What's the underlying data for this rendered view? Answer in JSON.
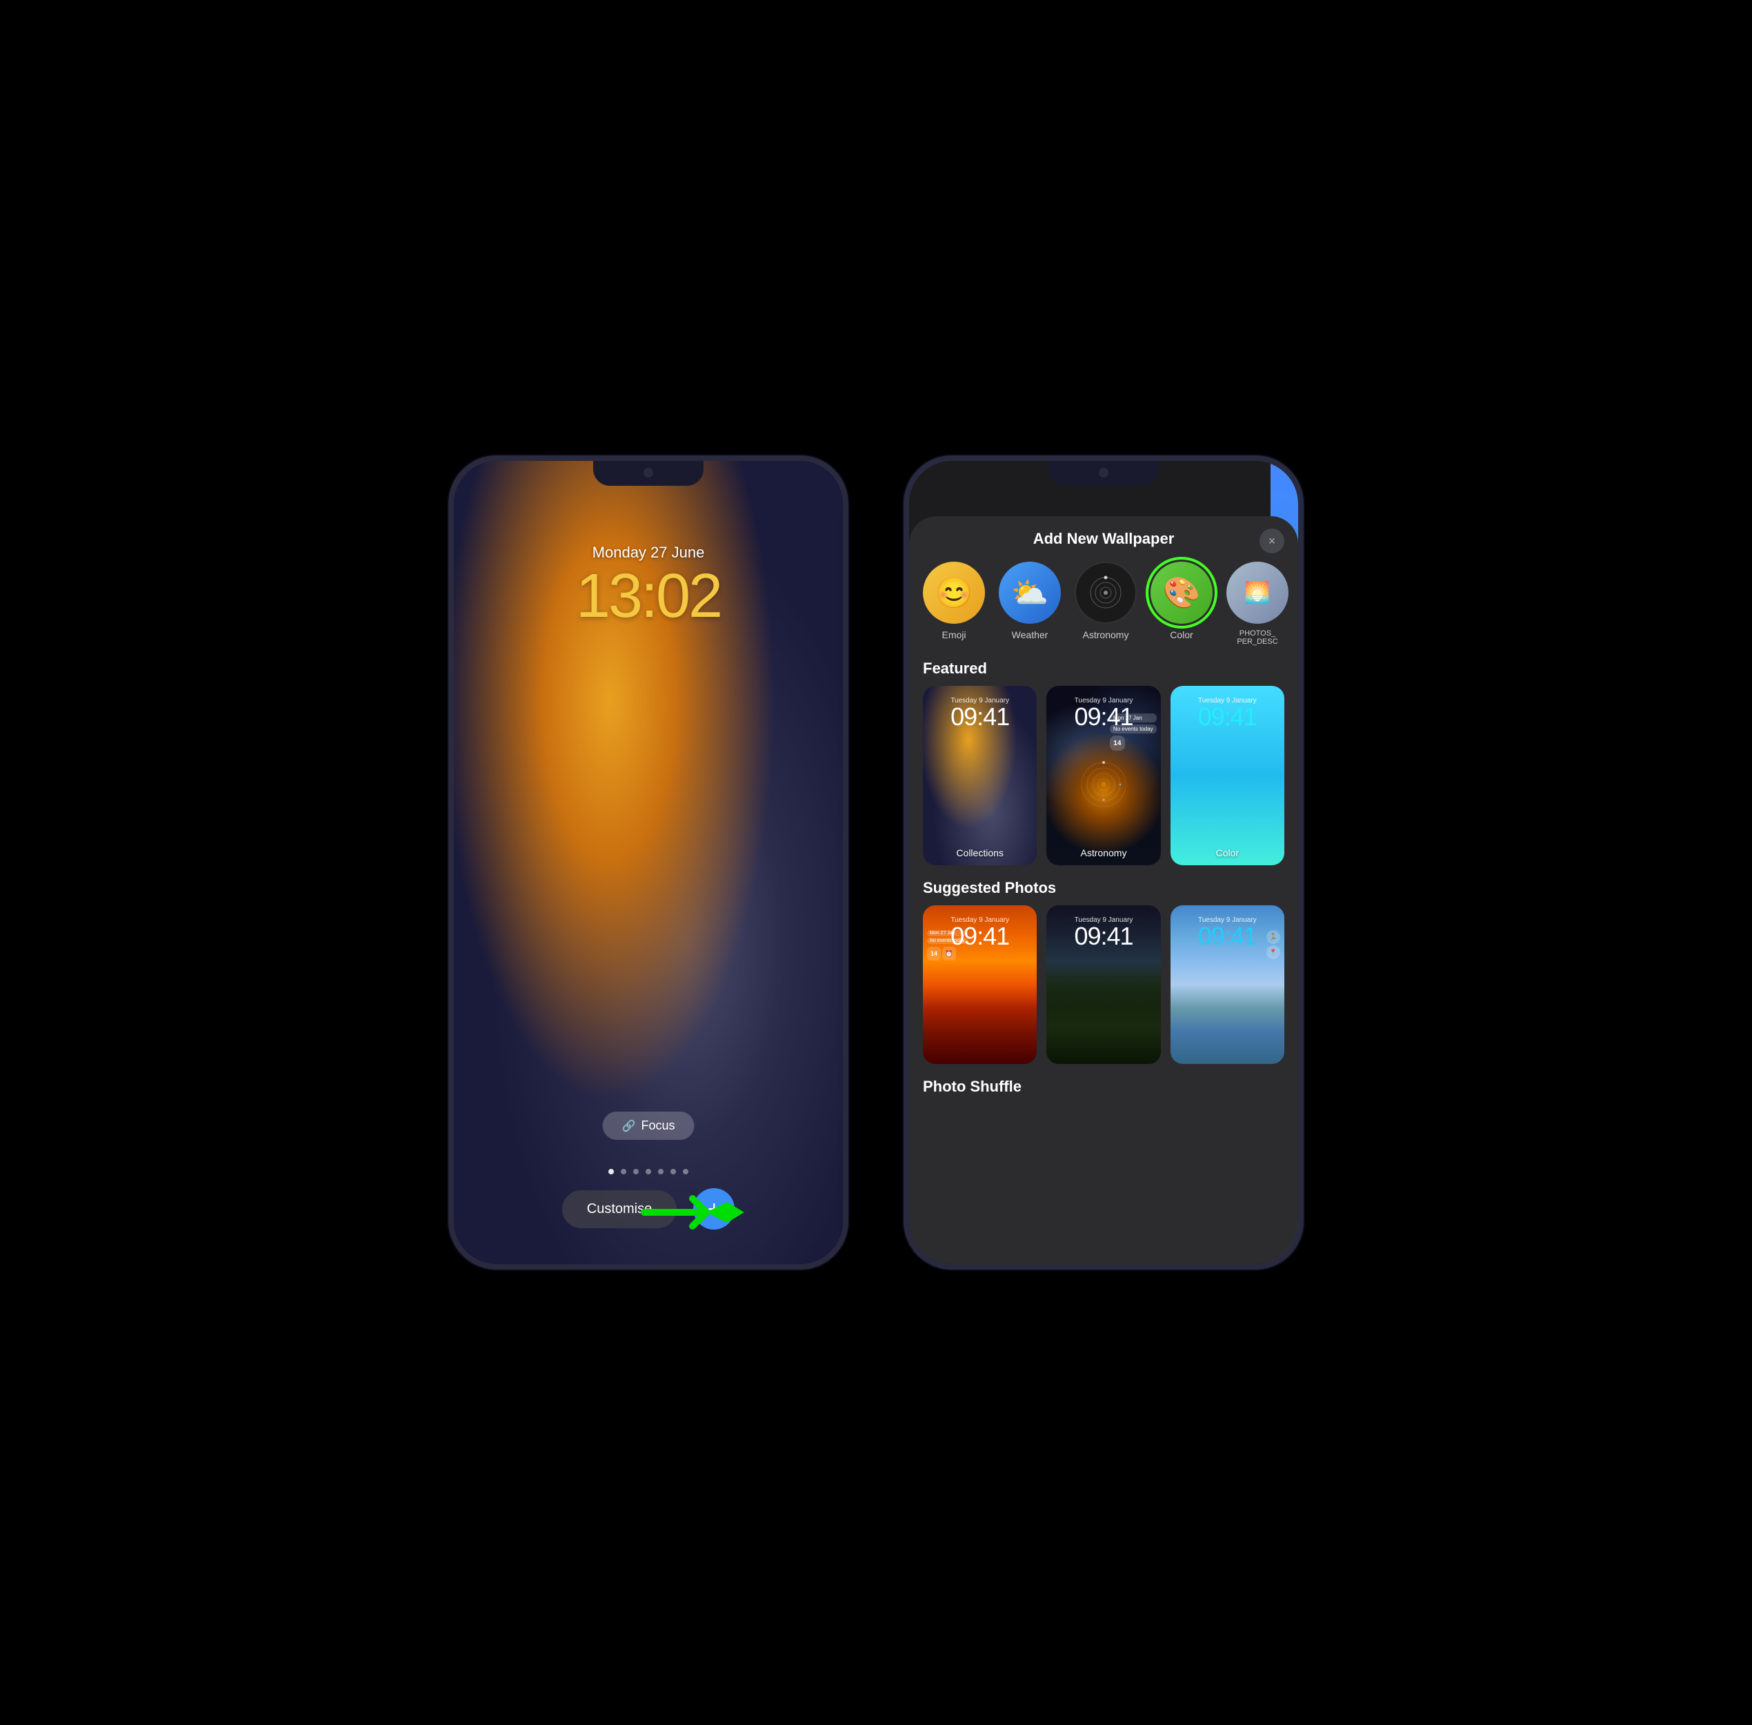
{
  "phone1": {
    "date": "Monday 27 June",
    "time": "13:02",
    "focus_label": "Focus",
    "customise_label": "Customise",
    "dots": [
      1,
      2,
      3,
      4,
      5,
      6,
      7
    ],
    "active_dot": 0
  },
  "phone2": {
    "modal_title": "Add New Wallpaper",
    "close_label": "×",
    "categories": [
      {
        "id": "emoji",
        "label": "Emoji",
        "icon": "😊"
      },
      {
        "id": "weather",
        "label": "Weather",
        "icon": "⛅"
      },
      {
        "id": "astronomy",
        "label": "Astronomy",
        "icon": "🔵"
      },
      {
        "id": "color",
        "label": "Color",
        "icon": "🎨"
      },
      {
        "id": "photos",
        "label": "PHOTOS_PER_DESC",
        "icon": "🖼"
      }
    ],
    "featured_label": "Featured",
    "featured": [
      {
        "id": "collections",
        "label": "Collections",
        "date": "Tuesday 9 January",
        "time": "09:41"
      },
      {
        "id": "astronomy",
        "label": "Astronomy",
        "date": "Tuesday 9 January",
        "time": "09:41"
      },
      {
        "id": "color",
        "label": "Color",
        "date": "Tuesday 9 January",
        "time": "09:41"
      }
    ],
    "suggested_label": "Suggested Photos",
    "suggested": [
      {
        "id": "sunset",
        "date": "Tuesday 9 January",
        "time": "09:41"
      },
      {
        "id": "forest",
        "date": "Tuesday 9 January",
        "time": "09:41"
      },
      {
        "id": "coast",
        "date": "Tuesday 9 January",
        "time": "09:41"
      }
    ],
    "photo_shuffle_label": "Photo Shuffle"
  }
}
